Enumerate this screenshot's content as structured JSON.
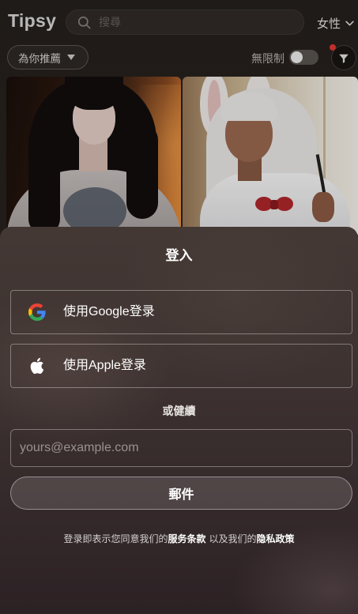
{
  "app": {
    "logo": "Tipsy"
  },
  "header": {
    "search": {
      "placeholder": "搜尋",
      "value": "",
      "icon": "search-icon"
    },
    "gender": {
      "label": "女性",
      "icon": "chevron-down-icon"
    }
  },
  "filters": {
    "recommend": {
      "label": "為你推薦",
      "icon": "caret-down-icon"
    },
    "unrestricted": {
      "label": "無限制",
      "enabled": false
    },
    "filter_button": {
      "icon": "filter-icon",
      "notification_dot": true
    }
  },
  "login": {
    "title": "登入",
    "google": {
      "label": "使用Google登录",
      "icon": "google-icon"
    },
    "apple": {
      "label": "使用Apple登录",
      "icon": "apple-icon"
    },
    "divider": "或健續",
    "email_input": {
      "placeholder": "yours@example.com",
      "value": ""
    },
    "email_button": {
      "label": "郵件"
    },
    "terms": {
      "prefix": "登录即表示您同意我们的",
      "terms_link": "服务条款",
      "middle": "以及我们的",
      "privacy_link": "隐私政策"
    }
  },
  "colors": {
    "notification": "#e53935",
    "text_primary": "#ffffff"
  }
}
